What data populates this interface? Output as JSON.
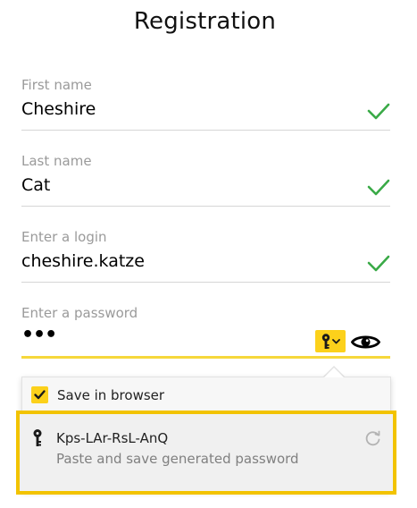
{
  "title": "Registration",
  "fields": {
    "first_name": {
      "label": "First name",
      "value": "Cheshire",
      "valid": true
    },
    "last_name": {
      "label": "Last name",
      "value": "Cat",
      "valid": true
    },
    "login": {
      "label": "Enter a login",
      "value": "cheshire.katze",
      "valid": true
    },
    "password": {
      "label": "Enter a password",
      "value": "•••"
    }
  },
  "popup": {
    "save_in_browser_label": "Save in browser",
    "save_in_browser_checked": true,
    "generated_password": "Kps-LAr-RsL-AnQ",
    "generated_hint": "Paste and save generated password"
  },
  "icons": {
    "valid": "check-icon",
    "password_manager": "key-dropdown-icon",
    "show_password": "eye-icon",
    "generated": "key-icon",
    "regenerate": "refresh-icon"
  },
  "colors": {
    "accent_yellow": "#fcd11b",
    "highlight_border": "#f2c300",
    "valid_green": "#3aaa47",
    "label_gray": "#9a9a9a"
  }
}
